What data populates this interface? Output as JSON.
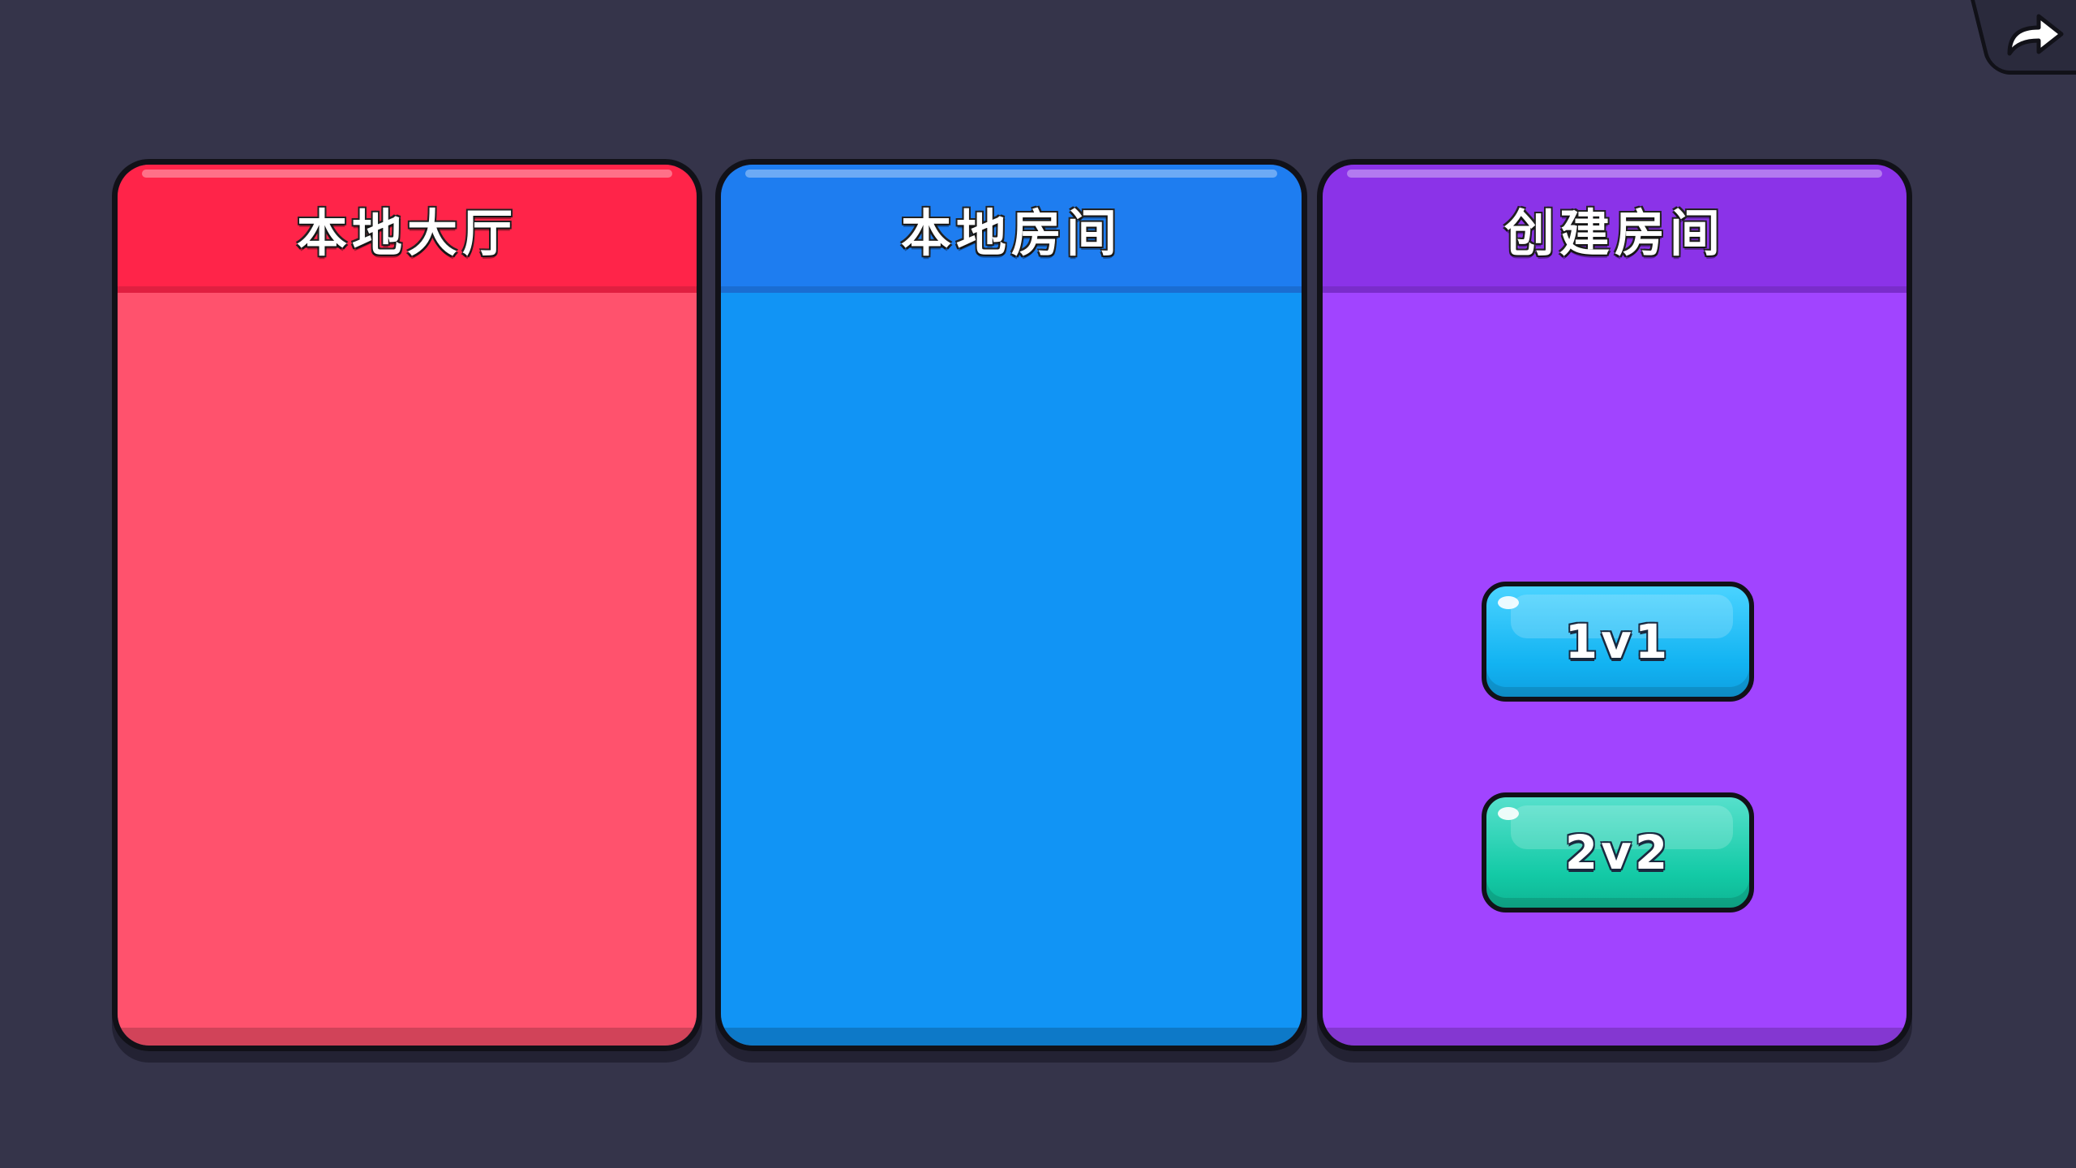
{
  "panels": {
    "lobby": {
      "title": "本地大厅"
    },
    "rooms": {
      "title": "本地房间"
    },
    "create": {
      "title": "创建房间",
      "modes": [
        "1v1",
        "2v2"
      ]
    }
  },
  "icons": {
    "back": "redo-arrow-icon"
  },
  "colors": {
    "background": "#35344a",
    "lobby_header": "#ff2449",
    "lobby_body": "#ff526d",
    "rooms_header": "#1e7df0",
    "rooms_body": "#1194f5",
    "create_header": "#8b33e8",
    "create_body": "#a144ff",
    "btn_1v1": "#12b3f2",
    "btn_2v2": "#13caa6"
  }
}
